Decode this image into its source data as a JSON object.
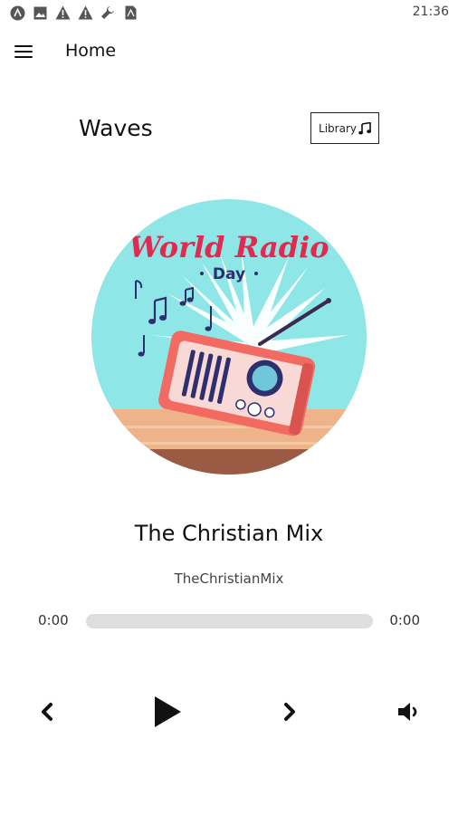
{
  "status_bar": {
    "time": "21:36",
    "icons": [
      "android-icon",
      "image-icon",
      "warning-icon",
      "warning-icon",
      "wrench-icon",
      "sim-icon"
    ]
  },
  "app_bar": {
    "menu_icon": "menu-icon",
    "title": "Home"
  },
  "header": {
    "brand": "Waves",
    "library_label": "Library",
    "library_icon": "music-note-icon"
  },
  "artwork": {
    "title_line1": "World Radio",
    "title_line2": "Day",
    "colors": {
      "sky": "#8ee6e6",
      "title": "#e02a4f",
      "radio": "#f26a62",
      "table": "#efb38a"
    }
  },
  "player": {
    "track_title": "The Christian Mix",
    "artist": "TheChristianMix",
    "current_time": "0:00",
    "total_time": "0:00",
    "progress": 0,
    "controls": [
      "previous-icon",
      "play-icon",
      "next-icon",
      "volume-icon"
    ]
  }
}
